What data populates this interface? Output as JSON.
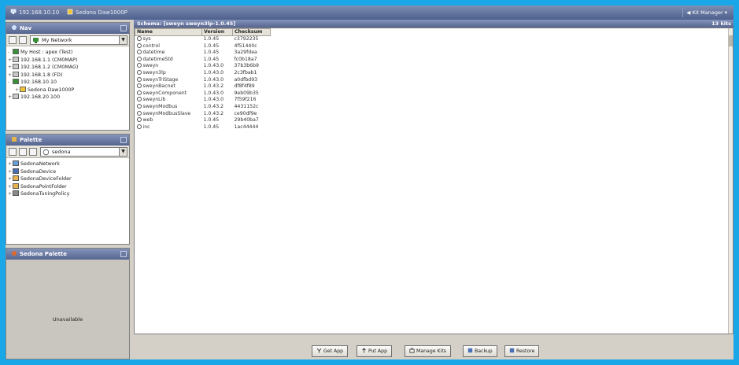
{
  "topbar": {
    "host": "192.168.10.10",
    "device": "Sedona Daw1000P",
    "right_label": "Kit Manager"
  },
  "nav_panel": {
    "title": "Nav",
    "combo_value": "My Network",
    "tree": [
      {
        "indent": 0,
        "exp": "-",
        "label": "My Host : apex (Test)"
      },
      {
        "indent": 0,
        "exp": "+",
        "label": "192.168.1.1 (CM0MAP)"
      },
      {
        "indent": 0,
        "exp": "+",
        "label": "192.168.1.2 (CM0MAG)"
      },
      {
        "indent": 0,
        "exp": "+",
        "label": "192.168.1.8 (FD)"
      },
      {
        "indent": 0,
        "exp": "-",
        "label": "192.168.10.10"
      },
      {
        "indent": 1,
        "exp": "+",
        "label": "Sedona Daw1000P"
      },
      {
        "indent": 0,
        "exp": "+",
        "label": "192.168.20.100"
      }
    ]
  },
  "palette_panel": {
    "title": "Palette",
    "combo_value": "sedona",
    "tree": [
      {
        "label": "SedonaNetwork"
      },
      {
        "label": "SedonaDevice"
      },
      {
        "label": "SedonaDeviceFolder"
      },
      {
        "label": "SedonaPointFolder"
      },
      {
        "label": "SedonaTuningPolicy"
      }
    ]
  },
  "sedona_palette": {
    "title": "Sedona Palette",
    "status": "Unavailable"
  },
  "main": {
    "title": "Schema: [sweyn sweyn3lp-1.0.45]",
    "right_label": "13 kits",
    "columns": [
      "Name",
      "Version",
      "Checksum"
    ],
    "rows": [
      {
        "name": "sys",
        "version": "1.0.45",
        "checksum": "c3792235"
      },
      {
        "name": "control",
        "version": "1.0.45",
        "checksum": "4f51440c"
      },
      {
        "name": "datetime",
        "version": "1.0.45",
        "checksum": "3a29fdea"
      },
      {
        "name": "datetimeStd",
        "version": "1.0.45",
        "checksum": "fc0b18a7"
      },
      {
        "name": "sweyn",
        "version": "1.0.43.0",
        "checksum": "37b3b6b9"
      },
      {
        "name": "sweyn3lp",
        "version": "1.0.43.0",
        "checksum": "2c3fbab1"
      },
      {
        "name": "sweynTriStage",
        "version": "1.0.43.0",
        "checksum": "a0dfbd93"
      },
      {
        "name": "sweynBacnet",
        "version": "1.0.43.2",
        "checksum": "df8f4f89"
      },
      {
        "name": "sweynComponent",
        "version": "1.0.43.0",
        "checksum": "9eb09b35"
      },
      {
        "name": "sweynLib",
        "version": "1.0.43.0",
        "checksum": "7f59f216"
      },
      {
        "name": "sweynModbus",
        "version": "1.0.43.2",
        "checksum": "4431152c"
      },
      {
        "name": "sweynModbusSlave",
        "version": "1.0.43.2",
        "checksum": "ce90df9e"
      },
      {
        "name": "web",
        "version": "1.0.45",
        "checksum": "29b40ba7"
      },
      {
        "name": "inc",
        "version": "1.0.45",
        "checksum": "1ac44444"
      }
    ]
  },
  "buttons": {
    "get_app": "Get App",
    "put_app": "Put App",
    "manage_kits": "Manage Kits",
    "backup": "Backup",
    "restore": "Restore"
  },
  "colors": {
    "frame": "#1aa7e8",
    "title_bar": "#56658f",
    "panel_bg": "#d4d0c8"
  }
}
